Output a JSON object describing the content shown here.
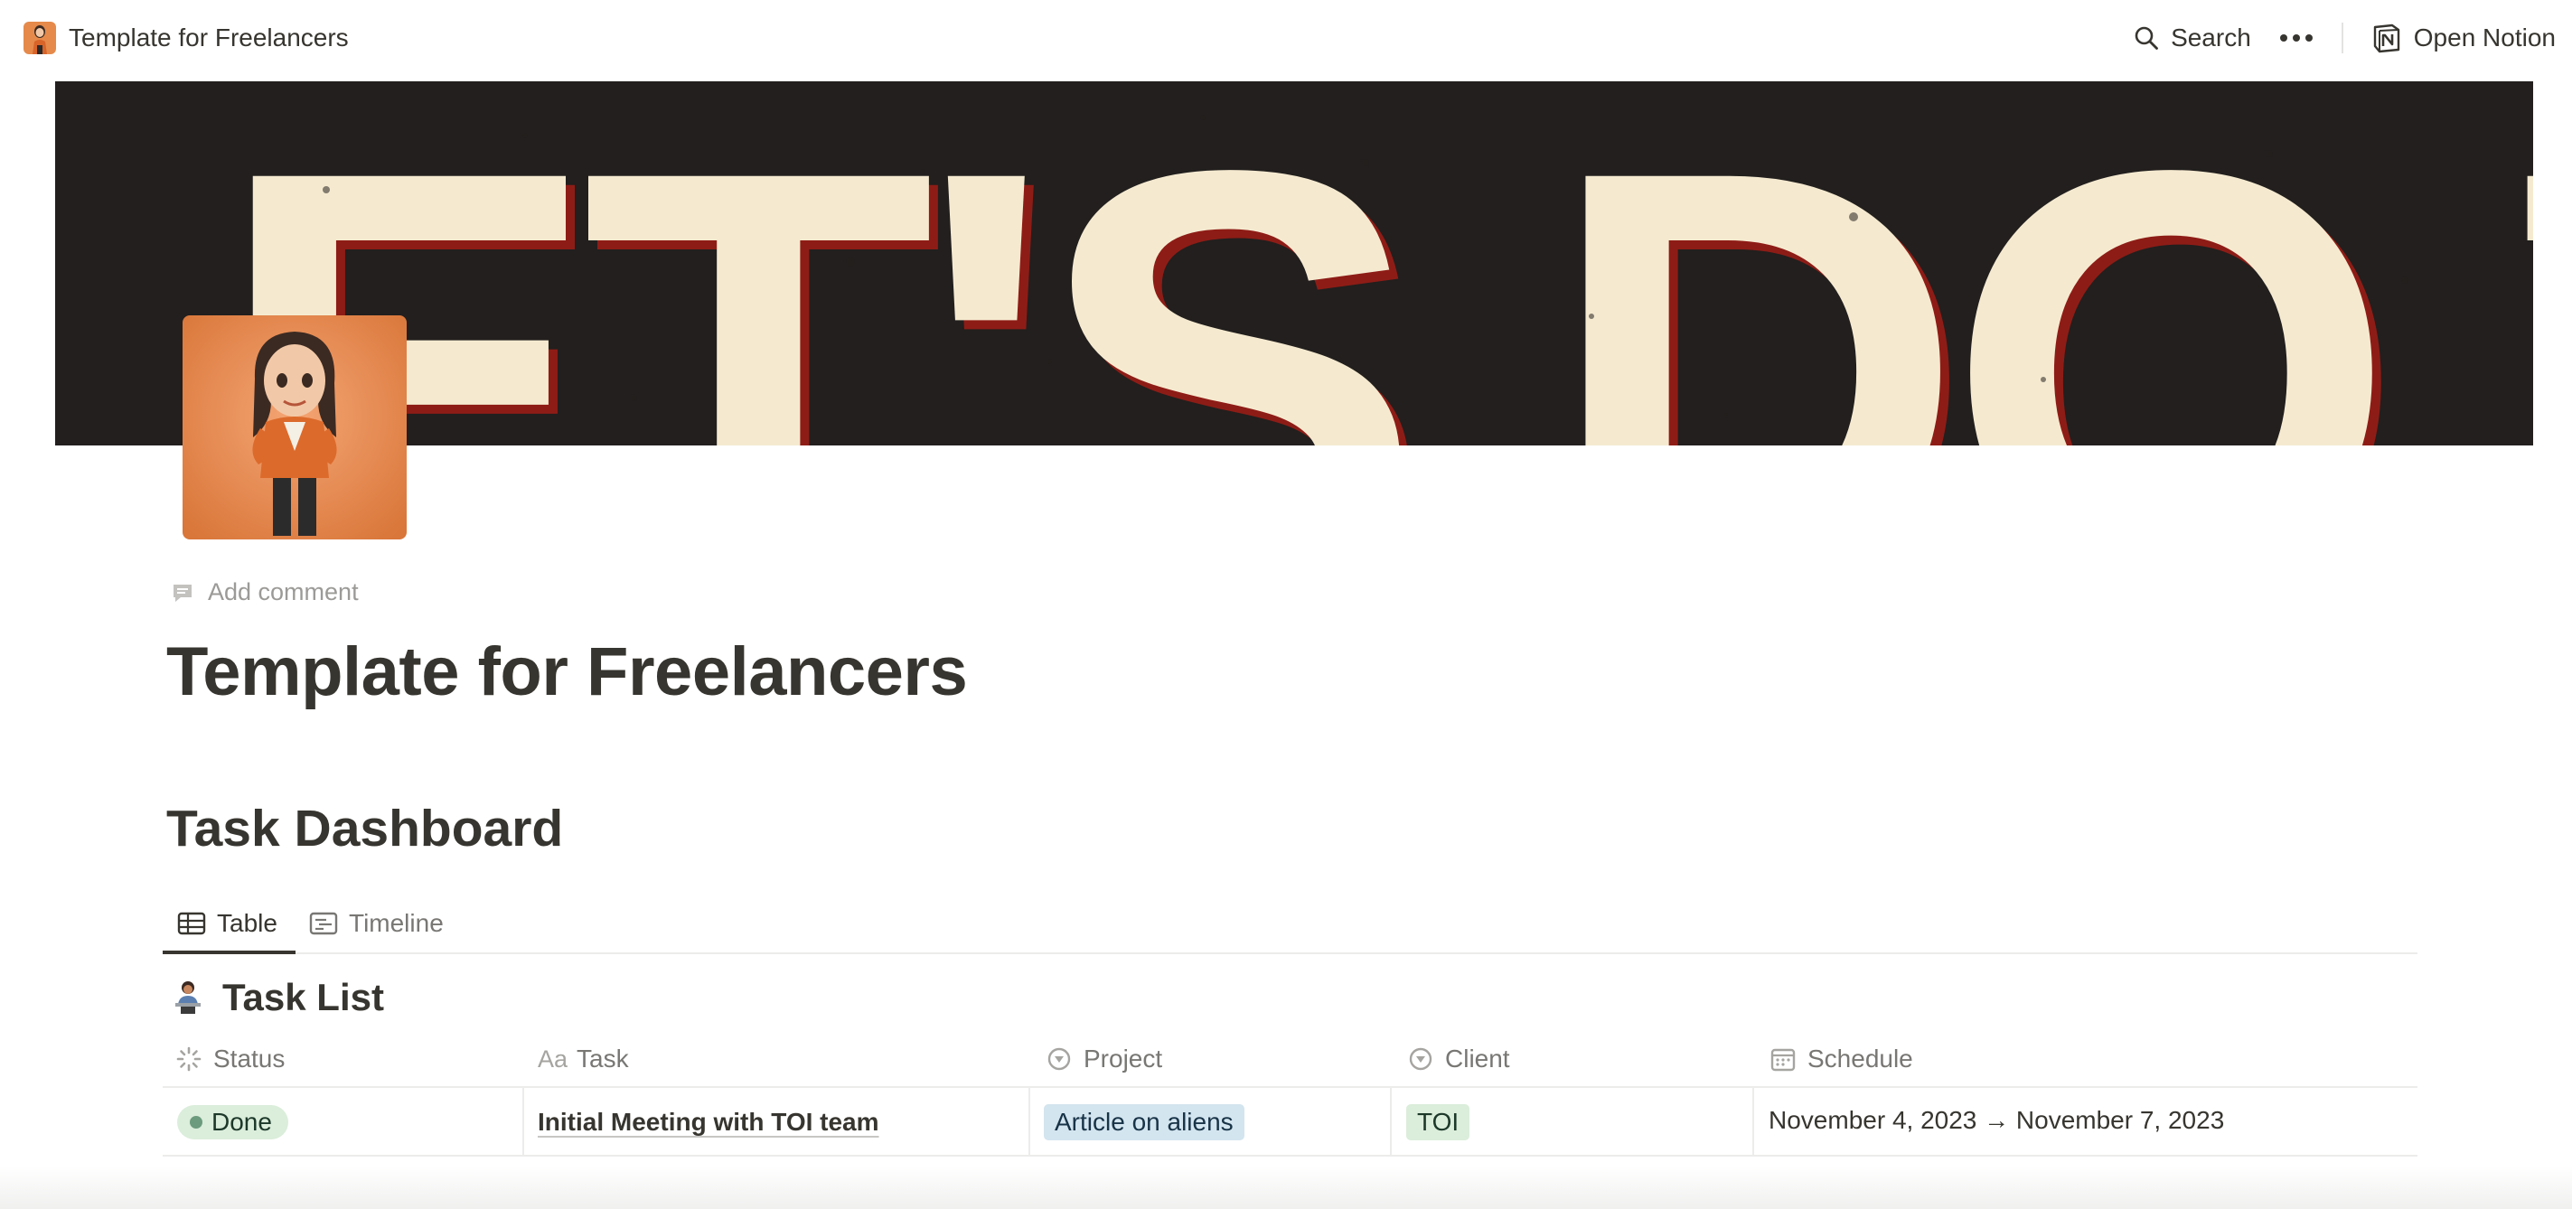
{
  "window": {
    "title": "Template for Freelancers",
    "actions": {
      "search": "Search",
      "open_notion": "Open Notion"
    }
  },
  "cover": {
    "text": "LET'S DO THIS",
    "colors": {
      "background": "#221f1e",
      "letters": "#f5ead0",
      "shadow": "#8e1c16"
    }
  },
  "page": {
    "add_comment": "Add comment",
    "title": "Template for Freelancers"
  },
  "dashboard": {
    "heading": "Task Dashboard",
    "tabs": [
      {
        "label": "Table",
        "icon": "table-icon",
        "active": true
      },
      {
        "label": "Timeline",
        "icon": "timeline-icon",
        "active": false
      }
    ],
    "database_title": "Task List",
    "columns": [
      {
        "label": "Status",
        "icon": "status-icon"
      },
      {
        "label": "Task",
        "icon": "text-aa-icon"
      },
      {
        "label": "Project",
        "icon": "select-icon"
      },
      {
        "label": "Client",
        "icon": "select-icon"
      },
      {
        "label": "Schedule",
        "icon": "calendar-icon"
      }
    ],
    "rows": [
      {
        "status": "Done",
        "task": "Initial Meeting with TOI team",
        "project": "Article on aliens",
        "client": "TOI",
        "schedule": "November 4, 2023 → November 7, 2023"
      }
    ]
  }
}
